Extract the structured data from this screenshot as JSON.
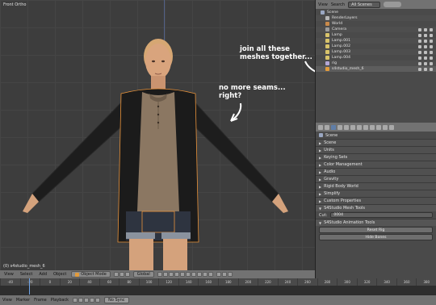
{
  "viewport": {
    "view_label": "Front Ortho",
    "object_label": "(0) s4studio_mesh_6"
  },
  "annotations": {
    "seams": "no more seams... right?",
    "join": "join all these meshes together..."
  },
  "viewport_header": {
    "view": "View",
    "select": "Select",
    "add": "Add",
    "object": "Object",
    "mode": "Object Mode",
    "pivot": "Global"
  },
  "timeline": {
    "ticks": [
      "-40",
      "-20",
      "0",
      "20",
      "40",
      "60",
      "80",
      "100",
      "120",
      "140",
      "160",
      "180",
      "200",
      "220",
      "240",
      "260",
      "280",
      "300",
      "320",
      "340",
      "360",
      "380"
    ],
    "view": "View",
    "marker": "Marker",
    "frame": "Frame",
    "playback": "Playback",
    "sync": "No Sync"
  },
  "outliner": {
    "view": "View",
    "search": "Search",
    "scenes_select": "All Scenes",
    "rows": [
      {
        "label": "Scene",
        "color": "#9aa7c2"
      },
      {
        "label": "RenderLayers",
        "color": "#b6b6b6"
      },
      {
        "label": "World",
        "color": "#c98a4a"
      },
      {
        "label": "Camera",
        "color": "#9c9c9c"
      },
      {
        "label": "Lamp",
        "color": "#d8c36a"
      },
      {
        "label": "Lamp.001",
        "color": "#d8c36a"
      },
      {
        "label": "Lamp.002",
        "color": "#d8c36a"
      },
      {
        "label": "Lamp.003",
        "color": "#d8c36a"
      },
      {
        "label": "Lamp.004",
        "color": "#d8c36a"
      },
      {
        "label": "rig",
        "color": "#b3a6d6"
      },
      {
        "label": "s4studio_mesh_6",
        "color": "#e29b3c"
      }
    ]
  },
  "properties": {
    "breadcrumb": "Scene",
    "panels_closed": [
      "Scene",
      "Units",
      "Keying Sets",
      "Color Management",
      "Audio",
      "Gravity",
      "Rigid Body World",
      "Simplify",
      "Custom Properties"
    ],
    "mesh_tools_label": "S4Studio Mesh Tools",
    "cut_label": "Cut:",
    "cut_value": "0004",
    "animation_tools_label": "S4Studio Animation Tools",
    "reset_rig": "Reset Rig",
    "hide_bones": "Hide Bones"
  },
  "colors": {
    "viewport_bg": "#3d3d3d",
    "selection_outline": "#e8923a",
    "cardigan": "#1b1b1b",
    "henley": "#8b7762",
    "skin": "#d4a27c"
  }
}
